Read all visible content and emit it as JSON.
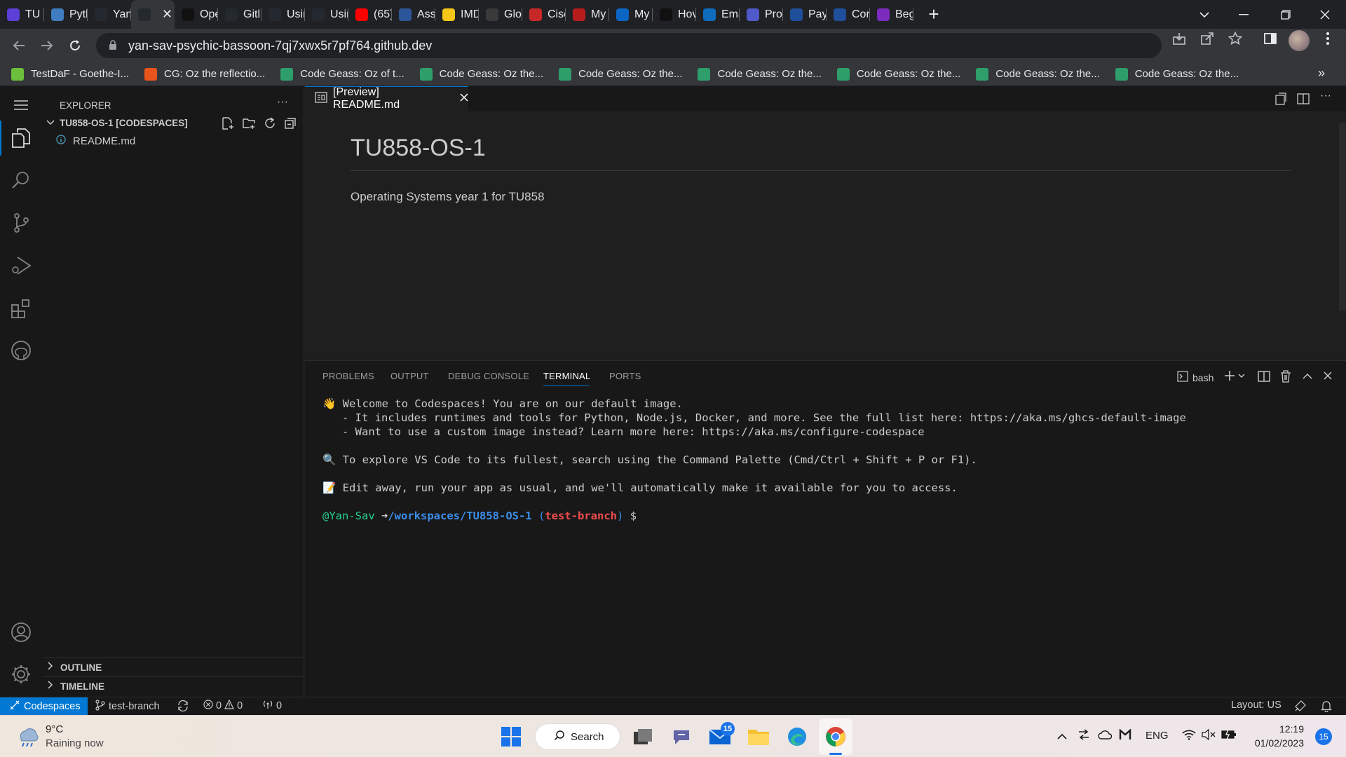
{
  "browser": {
    "tabs": [
      {
        "label": "TU",
        "color": "#5b3fd6"
      },
      {
        "label": "Pytl",
        "color": "#3f7cc0"
      },
      {
        "label": "Yan",
        "color": "#24292f"
      },
      {
        "label": "",
        "color": "#24292f",
        "active": true
      },
      {
        "label": "Ope",
        "color": "#111111"
      },
      {
        "label": "Gitl",
        "color": "#24292f"
      },
      {
        "label": "Usir",
        "color": "#24292f"
      },
      {
        "label": "Usir",
        "color": "#24292f"
      },
      {
        "label": "(65)",
        "color": "#ff0000"
      },
      {
        "label": "Assi",
        "color": "#2b579a"
      },
      {
        "label": "IMD",
        "color": "#f5c518"
      },
      {
        "label": "Glol",
        "color": "#3a3a3a"
      },
      {
        "label": "Cisc",
        "color": "#c62828"
      },
      {
        "label": "My",
        "color": "#b71c1c"
      },
      {
        "label": "My",
        "color": "#0a66c2"
      },
      {
        "label": "Hov",
        "color": "#111111"
      },
      {
        "label": "Ema",
        "color": "#0f6cbd"
      },
      {
        "label": "Prol",
        "color": "#5059c9"
      },
      {
        "label": "Pay",
        "color": "#1f4e9b"
      },
      {
        "label": "Cor",
        "color": "#1f4e9b"
      },
      {
        "label": "Beg",
        "color": "#7b2cbf"
      }
    ],
    "address": "yan-sav-psychic-bassoon-7qj7xwx5r7pf764.github.dev",
    "bookmarks": [
      {
        "label": "TestDaF - Goethe-I...",
        "color": "#6bbf3a"
      },
      {
        "label": "CG: Oz the reflectio...",
        "color": "#e8541c"
      },
      {
        "label": "Code Geass: Oz of t...",
        "color": "#2e9e6b"
      },
      {
        "label": "Code Geass: Oz the...",
        "color": "#2e9e6b"
      },
      {
        "label": "Code Geass: Oz the...",
        "color": "#2e9e6b"
      },
      {
        "label": "Code Geass: Oz the...",
        "color": "#2e9e6b"
      },
      {
        "label": "Code Geass: Oz the...",
        "color": "#2e9e6b"
      },
      {
        "label": "Code Geass: Oz the...",
        "color": "#2e9e6b"
      },
      {
        "label": "Code Geass: Oz the...",
        "color": "#2e9e6b"
      }
    ],
    "bookmarks_more": "»"
  },
  "vscode": {
    "explorer_title": "EXPLORER",
    "explorer_more": "···",
    "workspace": "TU858-OS-1 [CODESPACES]",
    "file": "README.md",
    "outline": "OUTLINE",
    "timeline": "TIMELINE",
    "editor_tab": "[Preview] README.md",
    "readme_heading": "TU858-OS-1",
    "readme_body": "Operating Systems year 1 for TU858",
    "panel_tabs": [
      "PROBLEMS",
      "OUTPUT",
      "DEBUG CONSOLE",
      "TERMINAL",
      "PORTS"
    ],
    "terminal_shell": "bash",
    "terminal_lines": {
      "l1": "👋 Welcome to Codespaces! You are on our default image.",
      "l2": "   - It includes runtimes and tools for Python, Node.js, Docker, and more. See the full list here: https://aka.ms/ghcs-default-image",
      "l3": "   - Want to use a custom image instead? Learn more here: https://aka.ms/configure-codespace",
      "l4": "🔍 To explore VS Code to its fullest, search using the Command Palette (Cmd/Ctrl + Shift + P or F1).",
      "l5": "📝 Edit away, run your app as usual, and we'll automatically make it available for you to access."
    },
    "prompt": {
      "user": "@Yan-Sav",
      "arrow": "➜",
      "path": "/workspaces/TU858-OS-1",
      "branch_open": "(",
      "branch": "test-branch",
      "branch_close": ")",
      "symbol": "$"
    },
    "status": {
      "remote": "Codespaces",
      "branch": "test-branch",
      "errors": "0",
      "warnings": "0",
      "ports": "0",
      "layout": "Layout: US"
    }
  },
  "taskbar": {
    "temp": "9°C",
    "weather": "Raining now",
    "search": "Search",
    "mail_badge": "15",
    "lang": "ENG",
    "time": "12:19",
    "date": "01/02/2023",
    "notif_count": "15"
  }
}
